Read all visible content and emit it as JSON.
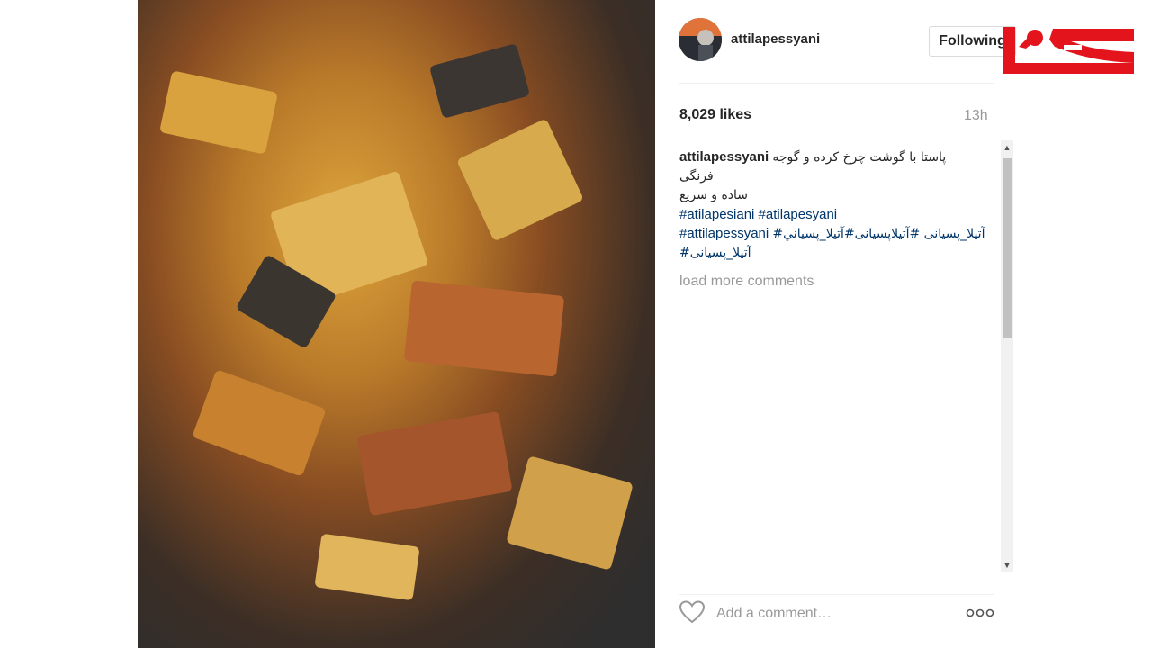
{
  "post": {
    "username": "attilapessyani",
    "follow_label": "Following",
    "likes": "8,029 likes",
    "time": "13h",
    "caption": {
      "user": "attilapessyani",
      "line1": "پاستا با گوشت چرخ کرده و گوجه",
      "line2": "فرنگی",
      "line3": "ساده و سریع",
      "tags_line1": "#atilapesiani #atilapesyani",
      "tags_line2_latin": "#attilapessyani",
      "tags_line2_persian": "#آتیلا_پسیانی #آتیلاپسیانی#آتیلا_پسياني",
      "tags_line3": "#آتیلا_پسیانی"
    },
    "load_more": "load more comments",
    "comment_placeholder": "Add a comment…"
  },
  "icons": {
    "heart": "heart-icon",
    "more": "more-options-icon",
    "scroll_up": "scroll-up-arrow-icon",
    "scroll_down": "scroll-down-arrow-icon"
  },
  "colors": {
    "tag": "#003569",
    "muted": "#999999",
    "logo_red": "#e3141c"
  }
}
